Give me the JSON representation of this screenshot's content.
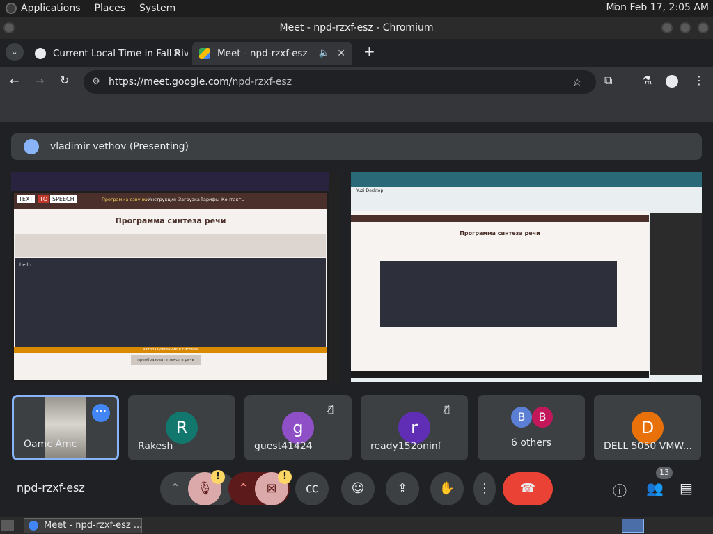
{
  "system_panel": {
    "menus": [
      "Applications",
      "Places",
      "System"
    ],
    "clock": "Mon Feb 17,  2:05 AM"
  },
  "window": {
    "title": "Meet - npd-rzxf-esz - Chromium"
  },
  "tabs": [
    {
      "label": "Current Local Time in Fall Riv",
      "active": false
    },
    {
      "label": "Meet - npd-rzxf-esz",
      "active": true
    }
  ],
  "address": {
    "url_host": "https://meet.google.com/",
    "url_path": "npd-rzxf-esz"
  },
  "meet": {
    "presenter_label": "vladimir vethov (Presenting)",
    "shared_left": {
      "brand_text": "TEXT",
      "brand_to": "TO",
      "brand_speech": "SPEECH",
      "nav": [
        "Программа озвучки",
        "Инструкция",
        "Загрузка",
        "Тарифы",
        "Контакты"
      ],
      "heading": "Программа синтеза речи",
      "input_text": "hello",
      "status": "Автоозвучивание в системе",
      "action": "преобразовать текст в речь"
    },
    "shared_right": {
      "window_label": "Yuzi Desktop",
      "heading": "Программа синтеза речи"
    },
    "participants": [
      {
        "name": "Oamc Amc",
        "initial": "",
        "color": "#6b6b6b"
      },
      {
        "name": "Rakesh",
        "initial": "R",
        "color": "#12786e"
      },
      {
        "name": "guest41424",
        "initial": "g",
        "color": "#8e4fc7"
      },
      {
        "name": "ready152oninf",
        "initial": "r",
        "color": "#5f2eb5"
      },
      {
        "name": "6 others",
        "initial": "B",
        "color": "#5a7fd4"
      },
      {
        "name": "DELL 5050 VMW...",
        "initial": "D",
        "color": "#e8710a"
      }
    ],
    "others_second_initial": "B",
    "meeting_code": "npd-rzxf-esz",
    "people_count": "13"
  },
  "taskbar": {
    "item": "Meet - npd-rzxf-esz ..."
  }
}
